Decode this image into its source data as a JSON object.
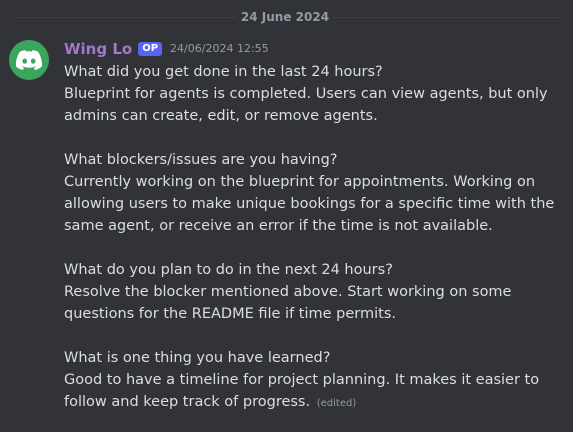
{
  "divider": {
    "date": "24 June 2024"
  },
  "message": {
    "author": "Wing Lo",
    "badge": "OP",
    "timestamp": "24/06/2024 12:55",
    "avatar_icon": "discord-logo-icon",
    "avatar_color": "#3ba55d",
    "author_color": "#a278c9",
    "edited": "(edited)",
    "sections": [
      {
        "question": "What did you get done in the last 24 hours?",
        "answer_lines": [
          "Blueprint for agents is completed. Users can view agents, but only",
          "admins can create, edit, or remove agents."
        ]
      },
      {
        "question": "What blockers/issues are you having?",
        "answer_lines": [
          "Currently working on the blueprint for appointments. Working on",
          "allowing users to make unique bookings for a specific time with the",
          "same agent, or receive an error if the time is not available."
        ]
      },
      {
        "question": "What do you plan to do in the next 24 hours?",
        "answer_lines": [
          "Resolve the blocker mentioned above. Start working on some",
          "questions for the README file if time permits."
        ]
      },
      {
        "question": "What is one thing you have learned?",
        "answer_lines": [
          "Good to have a timeline for project planning. It makes it easier to",
          "follow and keep track of progress."
        ]
      }
    ]
  }
}
